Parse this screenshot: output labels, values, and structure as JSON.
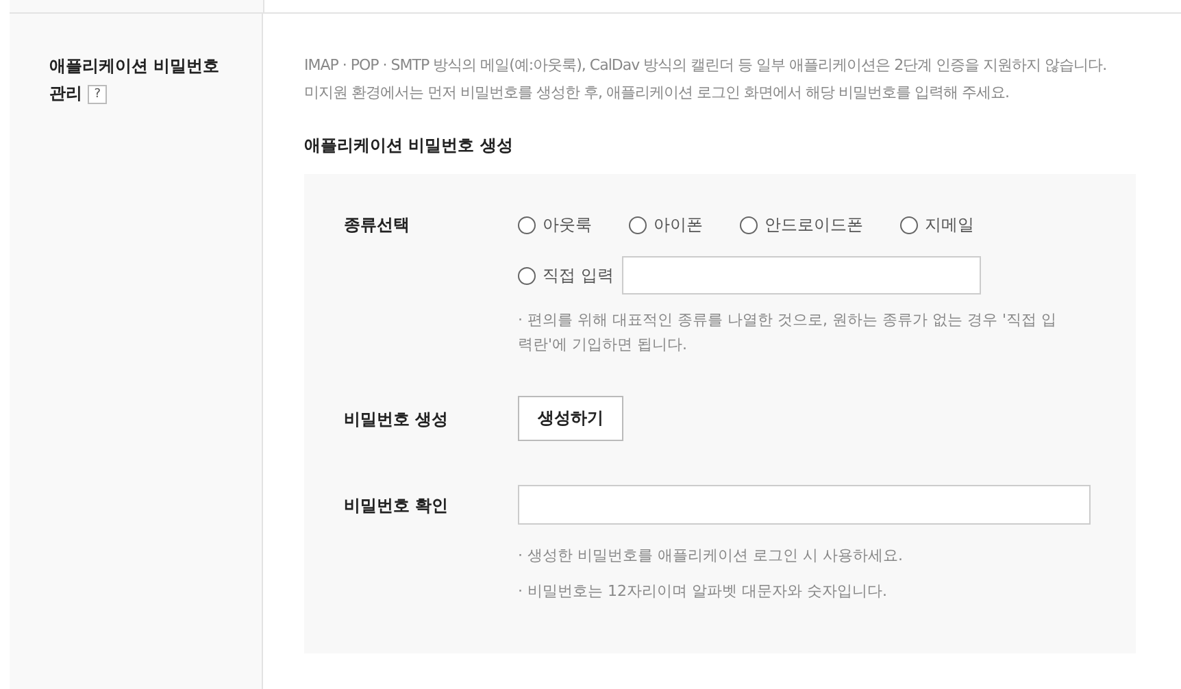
{
  "section": {
    "title": "애플리케이션 비밀번호 관리",
    "help": "?"
  },
  "description": [
    "IMAP · POP · SMTP 방식의 메일(예:아웃룩), CalDav 방식의 캘린더 등 일부 애플리케이션은 2단계 인증을 지원하지 않습니다.",
    "미지원 환경에서는 먼저 비밀번호를 생성한 후, 애플리케이션 로그인 화면에서 해당 비밀번호를 입력해 주세요."
  ],
  "subtitle": "애플리케이션 비밀번호 생성",
  "type_select": {
    "label": "종류선택",
    "options": [
      {
        "label": "아웃룩",
        "selected": false
      },
      {
        "label": "아이폰",
        "selected": false
      },
      {
        "label": "안드로이드폰",
        "selected": false
      },
      {
        "label": "지메일",
        "selected": false
      }
    ],
    "custom": {
      "label": "직접 입력",
      "selected": false
    },
    "note": "· 편의를 위해 대표적인 종류를 나열한 것으로, 원하는 종류가 없는 경우 '직접 입력란'에 기입하면 됩니다."
  },
  "generate": {
    "label": "비밀번호 생성",
    "button": "생성하기"
  },
  "confirm": {
    "label": "비밀번호 확인",
    "notes": [
      "· 생성한 비밀번호를 애플리케이션 로그인 시 사용하세요.",
      "· 비밀번호는 12자리이며 알파벳 대문자와 숫자입니다."
    ]
  }
}
